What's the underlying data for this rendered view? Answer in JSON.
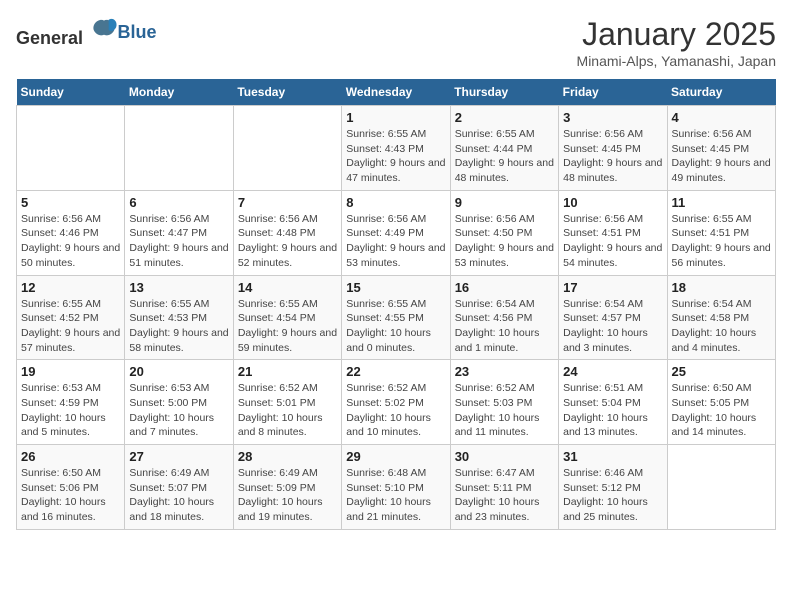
{
  "logo": {
    "general": "General",
    "blue": "Blue"
  },
  "header": {
    "title": "January 2025",
    "subtitle": "Minami-Alps, Yamanashi, Japan"
  },
  "weekdays": [
    "Sunday",
    "Monday",
    "Tuesday",
    "Wednesday",
    "Thursday",
    "Friday",
    "Saturday"
  ],
  "weeks": [
    [
      {
        "day": "",
        "info": ""
      },
      {
        "day": "",
        "info": ""
      },
      {
        "day": "",
        "info": ""
      },
      {
        "day": "1",
        "info": "Sunrise: 6:55 AM\nSunset: 4:43 PM\nDaylight: 9 hours and 47 minutes."
      },
      {
        "day": "2",
        "info": "Sunrise: 6:55 AM\nSunset: 4:44 PM\nDaylight: 9 hours and 48 minutes."
      },
      {
        "day": "3",
        "info": "Sunrise: 6:56 AM\nSunset: 4:45 PM\nDaylight: 9 hours and 48 minutes."
      },
      {
        "day": "4",
        "info": "Sunrise: 6:56 AM\nSunset: 4:45 PM\nDaylight: 9 hours and 49 minutes."
      }
    ],
    [
      {
        "day": "5",
        "info": "Sunrise: 6:56 AM\nSunset: 4:46 PM\nDaylight: 9 hours and 50 minutes."
      },
      {
        "day": "6",
        "info": "Sunrise: 6:56 AM\nSunset: 4:47 PM\nDaylight: 9 hours and 51 minutes."
      },
      {
        "day": "7",
        "info": "Sunrise: 6:56 AM\nSunset: 4:48 PM\nDaylight: 9 hours and 52 minutes."
      },
      {
        "day": "8",
        "info": "Sunrise: 6:56 AM\nSunset: 4:49 PM\nDaylight: 9 hours and 53 minutes."
      },
      {
        "day": "9",
        "info": "Sunrise: 6:56 AM\nSunset: 4:50 PM\nDaylight: 9 hours and 53 minutes."
      },
      {
        "day": "10",
        "info": "Sunrise: 6:56 AM\nSunset: 4:51 PM\nDaylight: 9 hours and 54 minutes."
      },
      {
        "day": "11",
        "info": "Sunrise: 6:55 AM\nSunset: 4:51 PM\nDaylight: 9 hours and 56 minutes."
      }
    ],
    [
      {
        "day": "12",
        "info": "Sunrise: 6:55 AM\nSunset: 4:52 PM\nDaylight: 9 hours and 57 minutes."
      },
      {
        "day": "13",
        "info": "Sunrise: 6:55 AM\nSunset: 4:53 PM\nDaylight: 9 hours and 58 minutes."
      },
      {
        "day": "14",
        "info": "Sunrise: 6:55 AM\nSunset: 4:54 PM\nDaylight: 9 hours and 59 minutes."
      },
      {
        "day": "15",
        "info": "Sunrise: 6:55 AM\nSunset: 4:55 PM\nDaylight: 10 hours and 0 minutes."
      },
      {
        "day": "16",
        "info": "Sunrise: 6:54 AM\nSunset: 4:56 PM\nDaylight: 10 hours and 1 minute."
      },
      {
        "day": "17",
        "info": "Sunrise: 6:54 AM\nSunset: 4:57 PM\nDaylight: 10 hours and 3 minutes."
      },
      {
        "day": "18",
        "info": "Sunrise: 6:54 AM\nSunset: 4:58 PM\nDaylight: 10 hours and 4 minutes."
      }
    ],
    [
      {
        "day": "19",
        "info": "Sunrise: 6:53 AM\nSunset: 4:59 PM\nDaylight: 10 hours and 5 minutes."
      },
      {
        "day": "20",
        "info": "Sunrise: 6:53 AM\nSunset: 5:00 PM\nDaylight: 10 hours and 7 minutes."
      },
      {
        "day": "21",
        "info": "Sunrise: 6:52 AM\nSunset: 5:01 PM\nDaylight: 10 hours and 8 minutes."
      },
      {
        "day": "22",
        "info": "Sunrise: 6:52 AM\nSunset: 5:02 PM\nDaylight: 10 hours and 10 minutes."
      },
      {
        "day": "23",
        "info": "Sunrise: 6:52 AM\nSunset: 5:03 PM\nDaylight: 10 hours and 11 minutes."
      },
      {
        "day": "24",
        "info": "Sunrise: 6:51 AM\nSunset: 5:04 PM\nDaylight: 10 hours and 13 minutes."
      },
      {
        "day": "25",
        "info": "Sunrise: 6:50 AM\nSunset: 5:05 PM\nDaylight: 10 hours and 14 minutes."
      }
    ],
    [
      {
        "day": "26",
        "info": "Sunrise: 6:50 AM\nSunset: 5:06 PM\nDaylight: 10 hours and 16 minutes."
      },
      {
        "day": "27",
        "info": "Sunrise: 6:49 AM\nSunset: 5:07 PM\nDaylight: 10 hours and 18 minutes."
      },
      {
        "day": "28",
        "info": "Sunrise: 6:49 AM\nSunset: 5:09 PM\nDaylight: 10 hours and 19 minutes."
      },
      {
        "day": "29",
        "info": "Sunrise: 6:48 AM\nSunset: 5:10 PM\nDaylight: 10 hours and 21 minutes."
      },
      {
        "day": "30",
        "info": "Sunrise: 6:47 AM\nSunset: 5:11 PM\nDaylight: 10 hours and 23 minutes."
      },
      {
        "day": "31",
        "info": "Sunrise: 6:46 AM\nSunset: 5:12 PM\nDaylight: 10 hours and 25 minutes."
      },
      {
        "day": "",
        "info": ""
      }
    ]
  ]
}
